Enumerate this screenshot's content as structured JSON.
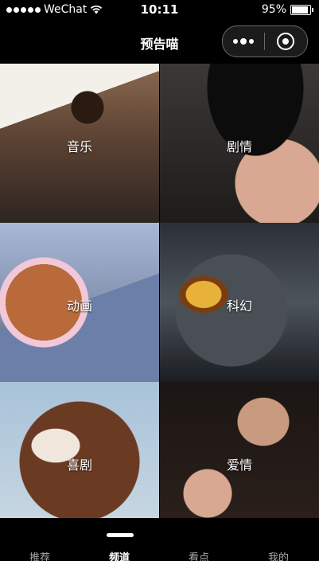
{
  "status_bar": {
    "carrier": "WeChat",
    "time": "10:11",
    "battery": "95%"
  },
  "nav": {
    "title": "预告喵"
  },
  "categories": [
    {
      "label": "音乐"
    },
    {
      "label": "剧情"
    },
    {
      "label": "动画"
    },
    {
      "label": "科幻"
    },
    {
      "label": "喜剧"
    },
    {
      "label": "爱情"
    }
  ],
  "tabs": [
    {
      "label": "推荐"
    },
    {
      "label": "频道"
    },
    {
      "label": "看点"
    },
    {
      "label": "我的"
    }
  ],
  "active_tab": "频道"
}
